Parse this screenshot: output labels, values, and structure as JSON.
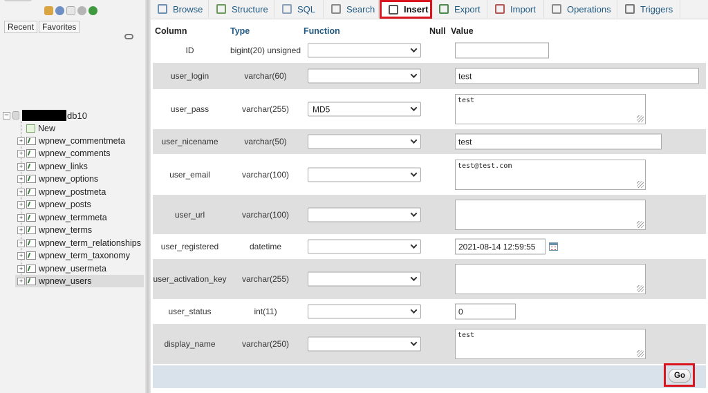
{
  "nav": {
    "quick_icons": [
      "home-icon",
      "info-icon",
      "docs-icon",
      "settings-icon",
      "reload-icon"
    ],
    "tabs": [
      "Recent",
      "Favorites"
    ],
    "db_name": "db10",
    "new_label": "New",
    "tables": [
      "wpnew_commentmeta",
      "wpnew_comments",
      "wpnew_links",
      "wpnew_options",
      "wpnew_postmeta",
      "wpnew_posts",
      "wpnew_termmeta",
      "wpnew_terms",
      "wpnew_term_relationships",
      "wpnew_term_taxonomy",
      "wpnew_usermeta",
      "wpnew_users"
    ],
    "selected_table": "wpnew_users"
  },
  "tabs": [
    {
      "label": "Browse",
      "icon": "browse-icon"
    },
    {
      "label": "Structure",
      "icon": "structure-icon"
    },
    {
      "label": "SQL",
      "icon": "sql-icon"
    },
    {
      "label": "Search",
      "icon": "search-icon"
    },
    {
      "label": "Insert",
      "icon": "insert-icon",
      "active": true
    },
    {
      "label": "Export",
      "icon": "export-icon"
    },
    {
      "label": "Import",
      "icon": "import-icon"
    },
    {
      "label": "Operations",
      "icon": "operations-icon"
    },
    {
      "label": "Triggers",
      "icon": "triggers-icon"
    }
  ],
  "form": {
    "headers": {
      "column": "Column",
      "type": "Type",
      "function": "Function",
      "null": "Null",
      "value": "Value"
    },
    "rows": [
      {
        "column": "ID",
        "type": "bigint(20) unsigned",
        "function": "",
        "value": ""
      },
      {
        "column": "user_login",
        "type": "varchar(60)",
        "function": "",
        "value": "test"
      },
      {
        "column": "user_pass",
        "type": "varchar(255)",
        "function": "MD5",
        "value": "test"
      },
      {
        "column": "user_nicename",
        "type": "varchar(50)",
        "function": "",
        "value": "test"
      },
      {
        "column": "user_email",
        "type": "varchar(100)",
        "function": "",
        "value": "test@test.com"
      },
      {
        "column": "user_url",
        "type": "varchar(100)",
        "function": "",
        "value": ""
      },
      {
        "column": "user_registered",
        "type": "datetime",
        "function": "",
        "value": "2021-08-14 12:59:55"
      },
      {
        "column": "user_activation_key",
        "type": "varchar(255)",
        "function": "",
        "value": ""
      },
      {
        "column": "user_status",
        "type": "int(11)",
        "function": "",
        "value": "0"
      },
      {
        "column": "display_name",
        "type": "varchar(250)",
        "function": "",
        "value": "test"
      }
    ],
    "go_label": "Go"
  },
  "colors": {
    "highlight": "#d9141d",
    "link": "#235a81",
    "row_alt": "#dfdfdf",
    "footer": "#d9e1ea"
  }
}
